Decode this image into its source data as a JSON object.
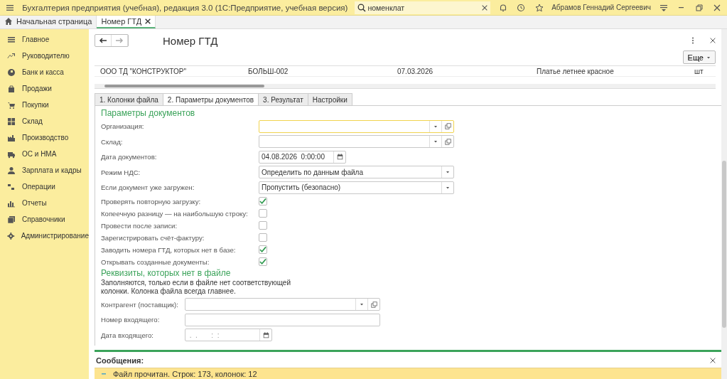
{
  "app_title": "Бухгалтерия предприятия (учебная), редакция 3.0  (1С:Предприятие, учебная версия)",
  "search": {
    "value": "номенклат"
  },
  "user": "Абрамов Геннадий Сергеевич",
  "open_tabs": [
    {
      "label": "Начальная страница",
      "selected": false,
      "kind": "home"
    },
    {
      "label": "Номер ГТД",
      "selected": true,
      "kind": "closable"
    }
  ],
  "sidebar": {
    "items": [
      {
        "label": "Главное"
      },
      {
        "label": "Руководителю"
      },
      {
        "label": "Банк и касса"
      },
      {
        "label": "Продажи"
      },
      {
        "label": "Покупки"
      },
      {
        "label": "Склад"
      },
      {
        "label": "Производство"
      },
      {
        "label": "ОС и НМА"
      },
      {
        "label": "Зарплата и кадры"
      },
      {
        "label": "Операции"
      },
      {
        "label": "Отчеты"
      },
      {
        "label": "Справочники"
      },
      {
        "label": "Администрирование"
      }
    ]
  },
  "form": {
    "title": "Номер ГТД",
    "more_button": "Еще",
    "table": {
      "rows": [
        {
          "cells": [
            "ООО ТД \"КОНСТРУКТОР\"",
            "БОЛЬШ-002",
            "07.03.2026",
            "Платье летнее красное",
            "шт"
          ]
        }
      ]
    },
    "tabs": [
      {
        "label": "1. Колонки файла",
        "selected": false
      },
      {
        "label": "2. Параметры документов",
        "selected": true
      },
      {
        "label": "3. Результат",
        "selected": false
      },
      {
        "label": "Настройки",
        "selected": false
      }
    ],
    "sections": [
      {
        "heading": "Параметры документов",
        "fields": [
          {
            "kind": "combo",
            "label": "Организация:",
            "focused": true
          },
          {
            "kind": "combo",
            "label": "Склад:",
            "focused": false
          },
          {
            "kind": "date",
            "label": "Дата документов:",
            "value": "04.08.2026  0:00:00"
          },
          {
            "kind": "select",
            "label": "Режим НДС:",
            "value": "Определить по данным файла"
          },
          {
            "kind": "select",
            "label": "Если документ уже загружен:",
            "value": "Пропустить (безопасно)"
          },
          {
            "kind": "checkbox",
            "label": "Проверять повторную загрузку:",
            "checked": true
          },
          {
            "kind": "checkbox",
            "label": "Копеечную разницу — на наибольшую строку:",
            "checked": false
          },
          {
            "kind": "checkbox",
            "label": "Провести после записи:",
            "checked": false
          },
          {
            "kind": "checkbox",
            "label": "Зарегистрировать счёт-фактуру:",
            "checked": false
          },
          {
            "kind": "checkbox",
            "label": "Заводить номера ГТД, которых нет в базе:",
            "checked": true
          },
          {
            "kind": "checkbox",
            "label": "Открывать созданные документы:",
            "checked": true
          }
        ]
      },
      {
        "heading": "Реквизиты, которых нет в файле",
        "note": "Заполняются, только если в файле нет соответствующей колонки. Колонка файла всегда главнее.",
        "fields": [
          {
            "kind": "combo",
            "label": "Контрагент (поставщик):",
            "focused": false
          },
          {
            "kind": "text",
            "label": "Номер входящего:"
          },
          {
            "kind": "date",
            "label": "Дата входящего:",
            "placeholder": " .  .       :  :"
          }
        ]
      }
    ]
  },
  "messages": {
    "title": "Сообщения:",
    "items": [
      {
        "text": "Файл прочитан. Строк: 173, колонок: 12"
      }
    ]
  }
}
